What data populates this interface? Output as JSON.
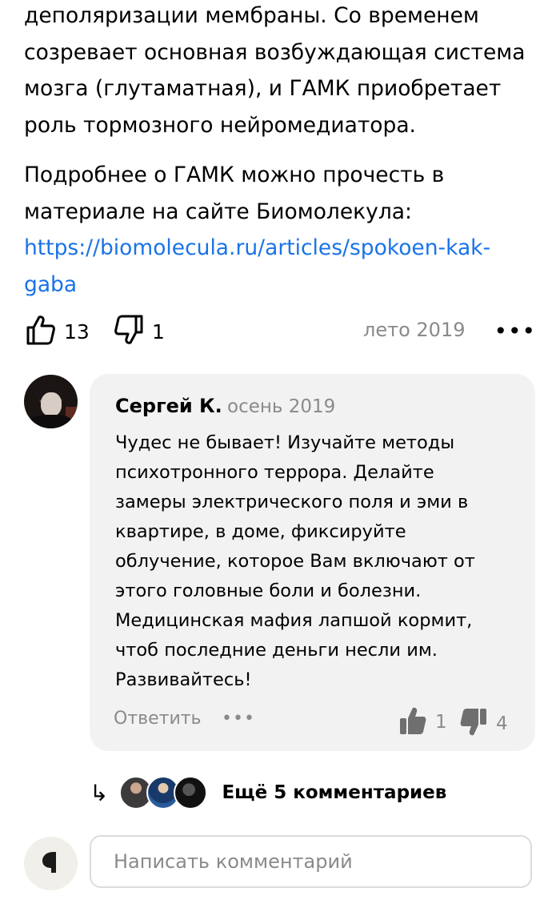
{
  "article": {
    "paragraph1_lines": [
      "деполяризации мембраны. Со временем",
      "созревает основная возбуждающая система",
      "мозга (глутаматная), и ГАМК приобретает",
      "роль тормозного нейромедиатора."
    ],
    "paragraph2_lines": [
      "Подробнее о ГАМК можно прочесть в",
      "материале на сайте Биомолекула:"
    ],
    "link_lines": [
      "https://biomolecula.ru/articles/spokoen-kak-",
      "gaba"
    ]
  },
  "actions": {
    "likes": "13",
    "dislikes": "1",
    "date": "лето 2019",
    "more": "•••"
  },
  "comment": {
    "author": "Сергей К.",
    "date": "осень 2019",
    "text_lines": [
      "Чудес не бывает! Изучайте методы",
      "психотронного террора. Делайте",
      "замеры электрического поля и эми в",
      "квартире, в доме, фиксируйте",
      "облучение, которое Вам включают от",
      "этого головные боли и болезни.",
      "Медицинская мафия лапшой кормит,",
      "чтоб последние деньги несли им.",
      "Развивайтесь!"
    ],
    "reply_label": "Ответить",
    "more": "•••",
    "likes": "1",
    "dislikes": "4"
  },
  "more_comments": {
    "arrow": "↳",
    "label": "Ещё 5 комментариев"
  },
  "composer": {
    "placeholder": "Написать комментарий"
  },
  "colors": {
    "link": "#1a73e8",
    "muted": "#8a8a8a",
    "bubble": "#f2f2f3"
  }
}
